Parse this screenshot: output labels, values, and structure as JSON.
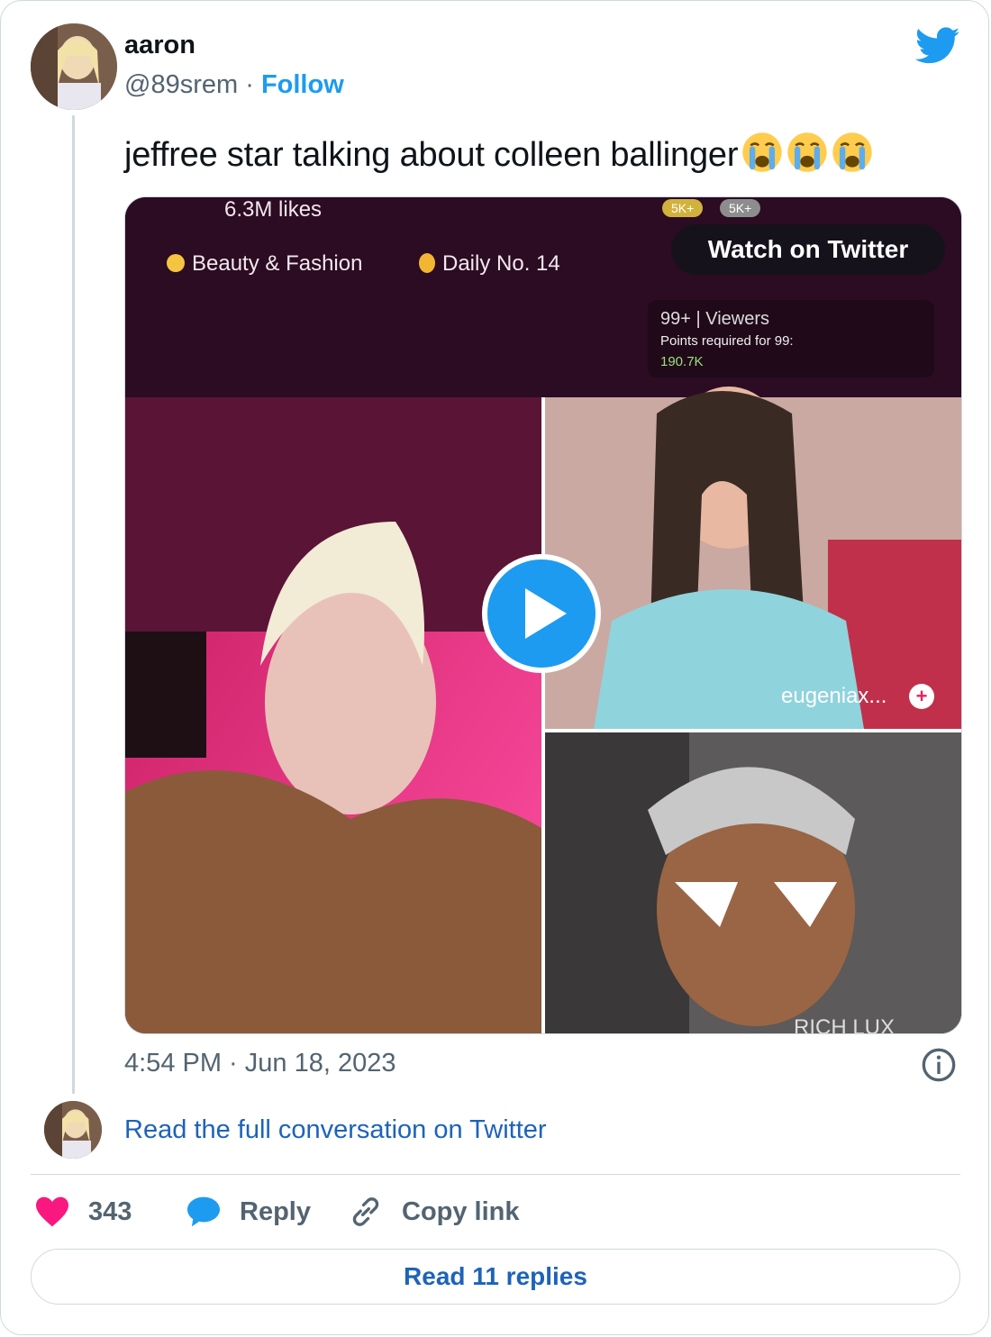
{
  "author": {
    "name": "aaron",
    "handle": "@89srem",
    "separator": "·",
    "follow_label": "Follow"
  },
  "tweet": {
    "text": "jeffree star talking about colleen ballinger",
    "emoji": [
      "loudly-crying-face",
      "loudly-crying-face",
      "loudly-crying-face"
    ],
    "timestamp": "4:54 PM · Jun 18, 2023"
  },
  "media": {
    "watch_label": "Watch on Twitter",
    "overlay": {
      "likes": "6.3M likes",
      "category": "Beauty & Fashion",
      "daily": "Daily No. 14",
      "viewers": "99+ | Viewers",
      "points_label": "Points required for 99:",
      "points_value": "190.7K",
      "badge1": "5K+",
      "badge2": "5K+",
      "guest1": "eugeniax...",
      "guest2": "RICH LUX"
    }
  },
  "conversation": {
    "read_label": "Read the full conversation on Twitter"
  },
  "actions": {
    "likes_count": "343",
    "reply_label": "Reply",
    "copy_label": "Copy link"
  },
  "replies": {
    "label": "Read 11 replies"
  },
  "colors": {
    "accent": "#1d9bf0",
    "link": "#1d63b9",
    "heart": "#f91880",
    "muted": "#536471",
    "border": "#cfd9de"
  }
}
